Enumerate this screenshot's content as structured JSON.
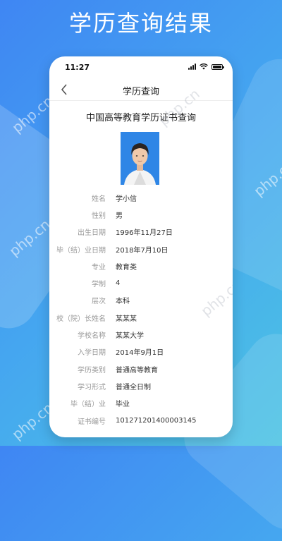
{
  "headline": "学历查询结果",
  "status_bar": {
    "time": "11:27"
  },
  "navbar": {
    "title": "学历查询"
  },
  "certificate": {
    "title": "中国高等教育学历证书查询",
    "fields": [
      {
        "label": "姓名",
        "value": "学小信"
      },
      {
        "label": "性别",
        "value": "男"
      },
      {
        "label": "出生日期",
        "value": "1996年11月27日"
      },
      {
        "label": "毕（结）业日期",
        "value": "2018年7月10日"
      },
      {
        "label": "专业",
        "value": "教育类"
      },
      {
        "label": "学制",
        "value": "4"
      },
      {
        "label": "层次",
        "value": "本科"
      },
      {
        "label": "校（院）长姓名",
        "value": "某某某"
      },
      {
        "label": "学校名称",
        "value": "某某大学"
      },
      {
        "label": "入学日期",
        "value": "2014年9月1日"
      },
      {
        "label": "学历类别",
        "value": "普通高等教育"
      },
      {
        "label": "学习形式",
        "value": "普通全日制"
      },
      {
        "label": "毕（结）业",
        "value": "毕业"
      },
      {
        "label": "证书编号",
        "value": "101271201400003145"
      }
    ]
  },
  "watermark": "php.cn",
  "colors": {
    "background_start": "#3f86f3",
    "background_end": "#4cc3e3",
    "photo_bg": "#2f86e6"
  },
  "icons": {
    "back": "chevron-left-icon",
    "signal": "signal-icon",
    "wifi": "wifi-icon",
    "battery": "battery-icon"
  }
}
